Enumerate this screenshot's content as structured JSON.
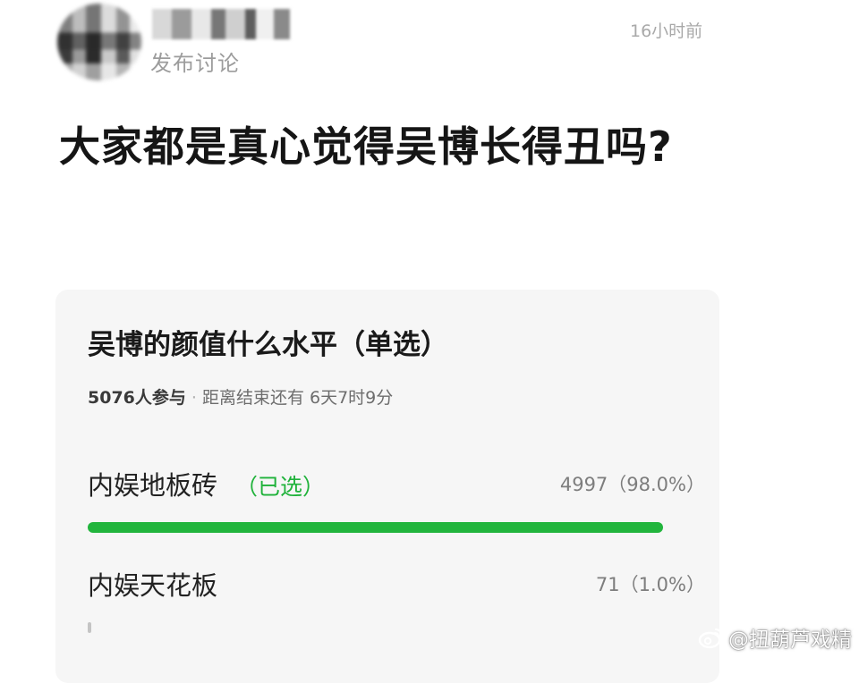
{
  "post": {
    "author_name": "",
    "action": "发布讨论",
    "time": "16小时前",
    "title": "大家都是真心觉得吴博长得丑吗?"
  },
  "poll": {
    "title": "吴博的颜值什么水平（单选）",
    "participants": "5076人参与",
    "separator": "·",
    "ends_in": "距离结束还有 6天7时9分",
    "options": [
      {
        "label": "内娱地板砖",
        "selected_tag": "（已选）",
        "result": "4997（98.0%）",
        "votes": 4997,
        "percent": 98.0,
        "selected": true
      },
      {
        "label": "内娱天花板",
        "selected_tag": "",
        "result": "71（1.0%）",
        "votes": 71,
        "percent": 1.0,
        "selected": false
      }
    ]
  },
  "watermark": {
    "icon": "weibo-icon",
    "text": "@扭葫芦戏精"
  },
  "colors": {
    "accent_green": "#22b53d",
    "selected_tag": "#1fb23a",
    "card_bg": "#f6f6f6"
  }
}
